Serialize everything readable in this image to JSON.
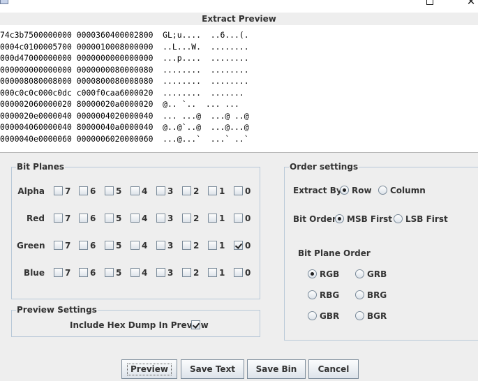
{
  "window": {
    "icon": "app-icon",
    "maximize_icon": "maximize-icon",
    "close_icon": "close-icon",
    "close_glyph": "✕"
  },
  "preview": {
    "title": "Extract Preview",
    "lines": [
      "74c3b7500000000 0000360400002800  GL;u....  ..6...(.",
      "0004c0100005700 0000010008000000  ..L...W.  ........",
      "000d47000000000 0000000000000000  ...p....  ........",
      "000000000000000 0000000080000080  ........  ........",
      "000008080008000 0000800080008080  ........  ........",
      "000c0c0c000c0dc c000f0caa6000020  ........  .......",
      "000002060000020 80000020a0000020  @.. `..  ... ...",
      "0000020e0000040 0000004020000040  ... ...@  ...@ ..@",
      "000004060000040 80000040a0000040  @..@`..@  ...@...@",
      "0000040e0000060 0000006020000060  ...@...`  ...` ..`"
    ]
  },
  "bit_planes": {
    "title": "Bit Planes",
    "bits": [
      "7",
      "6",
      "5",
      "4",
      "3",
      "2",
      "1",
      "0"
    ],
    "rows": [
      {
        "label": "Alpha",
        "checked": []
      },
      {
        "label": "Red",
        "checked": []
      },
      {
        "label": "Green",
        "checked": [
          "0"
        ]
      },
      {
        "label": "Blue",
        "checked": []
      }
    ]
  },
  "preview_settings": {
    "title": "Preview Settings",
    "hex_label": "Include Hex Dump In Preview",
    "hex_checked": true
  },
  "order_settings": {
    "title": "Order settings",
    "extract_by": {
      "label": "Extract By",
      "options": [
        "Row",
        "Column"
      ],
      "selected": "Row"
    },
    "bit_order": {
      "label": "Bit Order",
      "options": [
        "MSB First",
        "LSB First"
      ],
      "selected": "MSB First"
    },
    "plane_order": {
      "label": "Bit Plane Order",
      "options": [
        "RGB",
        "GRB",
        "RBG",
        "BRG",
        "GBR",
        "BGR"
      ],
      "selected": "RGB"
    }
  },
  "buttons": {
    "preview": "Preview",
    "save_text": "Save Text",
    "save_bin": "Save Bin",
    "cancel": "Cancel"
  }
}
